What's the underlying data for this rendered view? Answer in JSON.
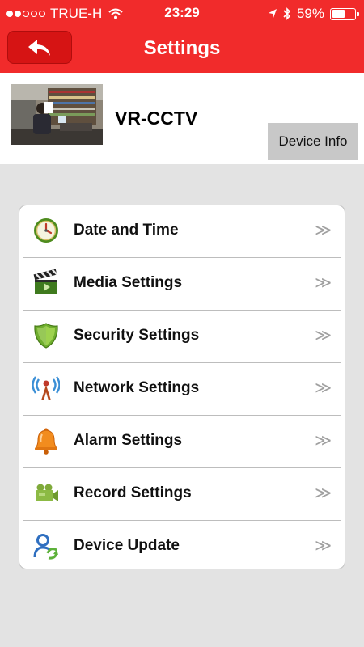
{
  "status_bar": {
    "carrier": "TRUE-H",
    "time": "23:29",
    "battery": "59%",
    "battery_level": 0.59,
    "signal_bars_filled": 2,
    "signal_bars_total": 5
  },
  "header": {
    "title": "Settings"
  },
  "device": {
    "name": "VR-CCTV",
    "info_button": "Device Info"
  },
  "menu": {
    "items": [
      {
        "label": "Date and Time",
        "icon": "clock-icon",
        "chevron": "≫"
      },
      {
        "label": "Media Settings",
        "icon": "clapperboard-icon",
        "chevron": "≫"
      },
      {
        "label": "Security Settings",
        "icon": "shield-icon",
        "chevron": "≫"
      },
      {
        "label": "Network Settings",
        "icon": "antenna-icon",
        "chevron": "≫"
      },
      {
        "label": "Alarm Settings",
        "icon": "bell-icon",
        "chevron": "≫"
      },
      {
        "label": "Record Settings",
        "icon": "camcorder-icon",
        "chevron": "≫"
      },
      {
        "label": "Device Update",
        "icon": "update-icon",
        "chevron": "≫"
      }
    ]
  },
  "colors": {
    "header": "#f12b2b",
    "back_button": "#d61414",
    "background": "#e3e3e3"
  }
}
